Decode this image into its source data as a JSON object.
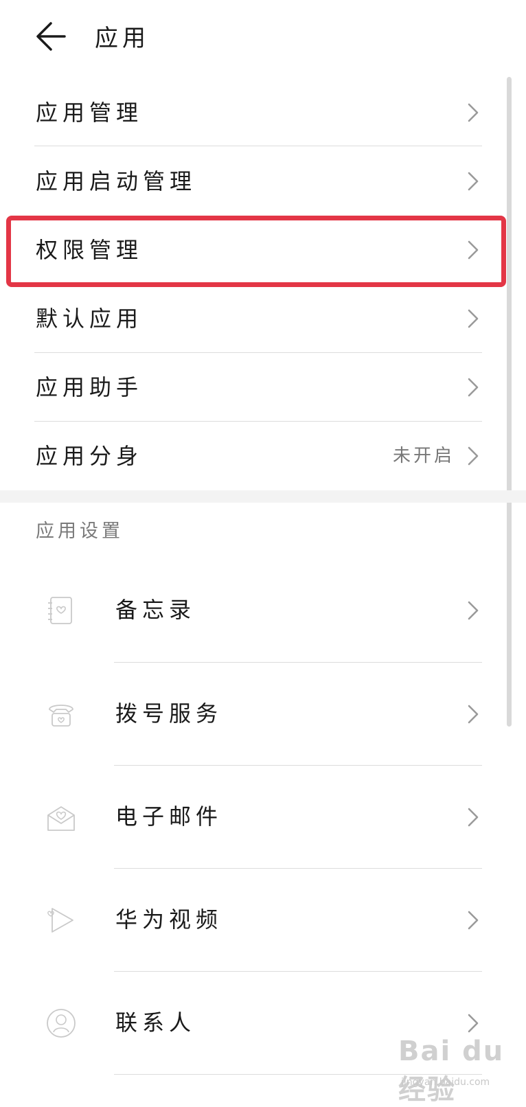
{
  "header": {
    "title": "应用",
    "back_icon": "arrow-left-icon"
  },
  "menu": [
    {
      "label": "应用管理"
    },
    {
      "label": "应用启动管理"
    },
    {
      "label": "权限管理"
    },
    {
      "label": "默认应用"
    },
    {
      "label": "应用助手"
    },
    {
      "label": "应用分身",
      "value": "未开启"
    }
  ],
  "section": {
    "title": "应用设置"
  },
  "apps": [
    {
      "label": "备忘录",
      "icon": "notepad-icon"
    },
    {
      "label": "拨号服务",
      "icon": "telephone-icon"
    },
    {
      "label": "电子邮件",
      "icon": "envelope-icon"
    },
    {
      "label": "华为视频",
      "icon": "play-icon"
    },
    {
      "label": "联系人",
      "icon": "contact-icon"
    }
  ],
  "watermark": {
    "brand": "Bai du 经验",
    "url": "jingyan.baidu.com"
  },
  "colors": {
    "highlight": "#e33646",
    "chevron": "#9a9a9a",
    "divider": "#dcdcdc"
  }
}
